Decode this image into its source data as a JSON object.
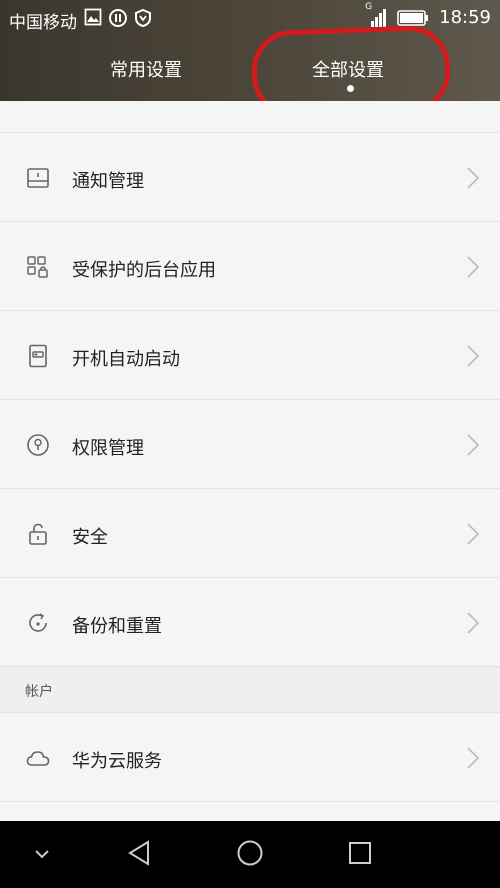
{
  "status": {
    "carrier": "中国移动",
    "signal_label": "G",
    "time": "18:59"
  },
  "tabs": [
    {
      "label": "常用设置",
      "active": false
    },
    {
      "label": "全部设置",
      "active": true
    }
  ],
  "items": [
    {
      "label": "通知管理",
      "icon": "notification-icon"
    },
    {
      "label": "受保护的后台应用",
      "icon": "protected-apps-icon"
    },
    {
      "label": "开机自动启动",
      "icon": "autostart-icon"
    },
    {
      "label": "权限管理",
      "icon": "permission-icon"
    },
    {
      "label": "安全",
      "icon": "lock-icon"
    },
    {
      "label": "备份和重置",
      "icon": "backup-icon"
    }
  ],
  "section": {
    "label": "帐户"
  },
  "account_items": [
    {
      "label": "华为云服务",
      "icon": "cloud-icon"
    }
  ],
  "colors": {
    "header": "#4a4438",
    "highlight": "#d41a1a",
    "background": "#f5f5f5"
  }
}
